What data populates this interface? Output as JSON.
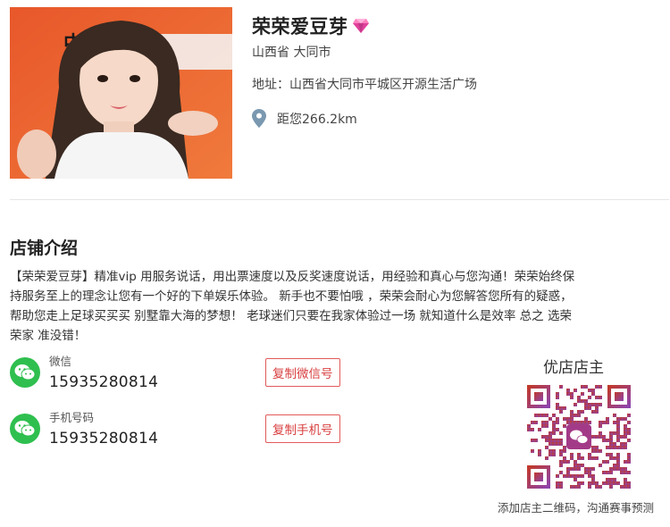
{
  "store": {
    "name": "荣荣爱豆芽",
    "region": "山西省 大同市",
    "address": "地址：山西省大同市平城区开源生活广场",
    "distance": "距您266.2km"
  },
  "photo_banner_text": "中国体育",
  "intro": {
    "title": "店铺介绍",
    "text": "【荣荣爱豆芽】精准vip 用服务说话，用出票速度以及反奖速度说话，用经验和真心与您沟通！荣荣始终保持服务至上的理念让您有一个好的下单娱乐体验。 新手也不要怕哦 ，荣荣会耐心为您解答您所有的疑惑，帮助您走上足球买买买 别墅靠大海的梦想！ 老球迷们只要在我家体验过一场 就知道什么是效率 总之 选荣荣家 准没错！"
  },
  "contacts": {
    "wechat": {
      "label": "微信",
      "value": "15935280814",
      "button": "复制微信号"
    },
    "phone": {
      "label": "手机号码",
      "value": "15935280814",
      "button": "复制手机号"
    }
  },
  "qr": {
    "title": "优店店主",
    "caption": "添加店主二维码，沟通赛事预测"
  },
  "colors": {
    "wechat_green": "#2fbf4f",
    "button_red": "#d94040",
    "qr_gradient_start": "#c0392b",
    "qr_gradient_end": "#8e44ad"
  },
  "icons": [
    "gem-icon",
    "location-pin-icon",
    "wechat-icon",
    "qr-code-icon"
  ]
}
